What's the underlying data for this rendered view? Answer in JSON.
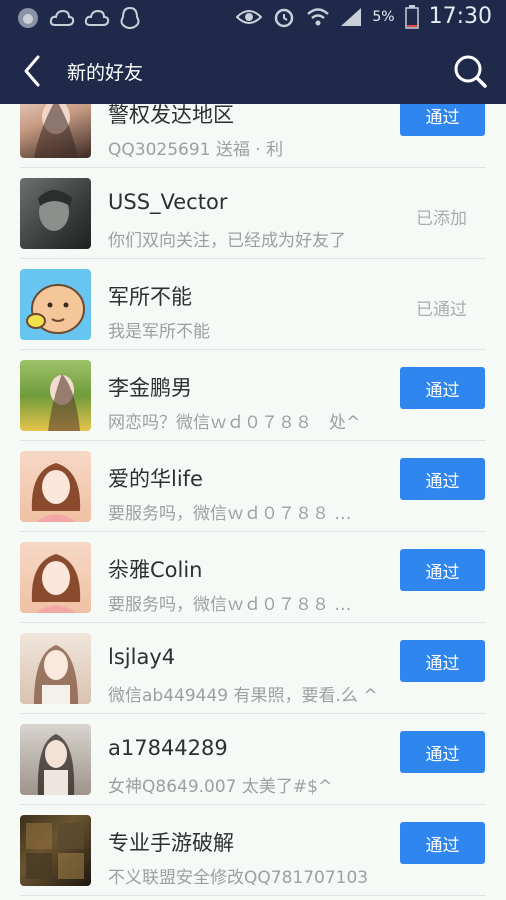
{
  "status_bar": {
    "battery_percent": "5%",
    "time": "17:30",
    "icons": [
      "weibo-icon",
      "cloud-icon",
      "cloud-icon",
      "qq-icon",
      "eye-icon",
      "alarm-icon",
      "wifi-icon",
      "signal-icon",
      "battery-icon"
    ]
  },
  "header": {
    "title": "新的好友",
    "back_icon": "chevron-left-icon",
    "search_icon": "search-icon"
  },
  "friends": [
    {
      "name": "警权发达地区",
      "message": "QQ3025691  送福 · 利",
      "action": "通过",
      "state": ""
    },
    {
      "name": "USS_Vector",
      "message": "你们双向关注，已经成为好友了",
      "action": "",
      "state": "已添加"
    },
    {
      "name": "军所不能",
      "message": "我是军所不能",
      "action": "",
      "state": "已通过"
    },
    {
      "name": "李金鹏男",
      "message": "网恋吗？微信ｗｄ０７８８　处^",
      "action": "通过",
      "state": ""
    },
    {
      "name": "爱的华life",
      "message": "要服务吗，微信ｗｄ０７８８ …",
      "action": "通过",
      "state": ""
    },
    {
      "name": "尜雅Colin",
      "message": "要服务吗，微信ｗｄ０７８８ …",
      "action": "通过",
      "state": ""
    },
    {
      "name": "lsjlay4",
      "message": "微信ab449449 有果照，要看.么 ^",
      "action": "通过",
      "state": ""
    },
    {
      "name": "a17844289",
      "message": "女神Q8649.007 太美了#$^",
      "action": "通过",
      "state": ""
    },
    {
      "name": "专业手游破解",
      "message": "不义联盟安全修改QQ781707103",
      "action": "通过",
      "state": ""
    }
  ],
  "colors": {
    "header_bg": "#1f2a4b",
    "accent_button": "#2f86ef",
    "page_bg": "#f6faf7"
  }
}
